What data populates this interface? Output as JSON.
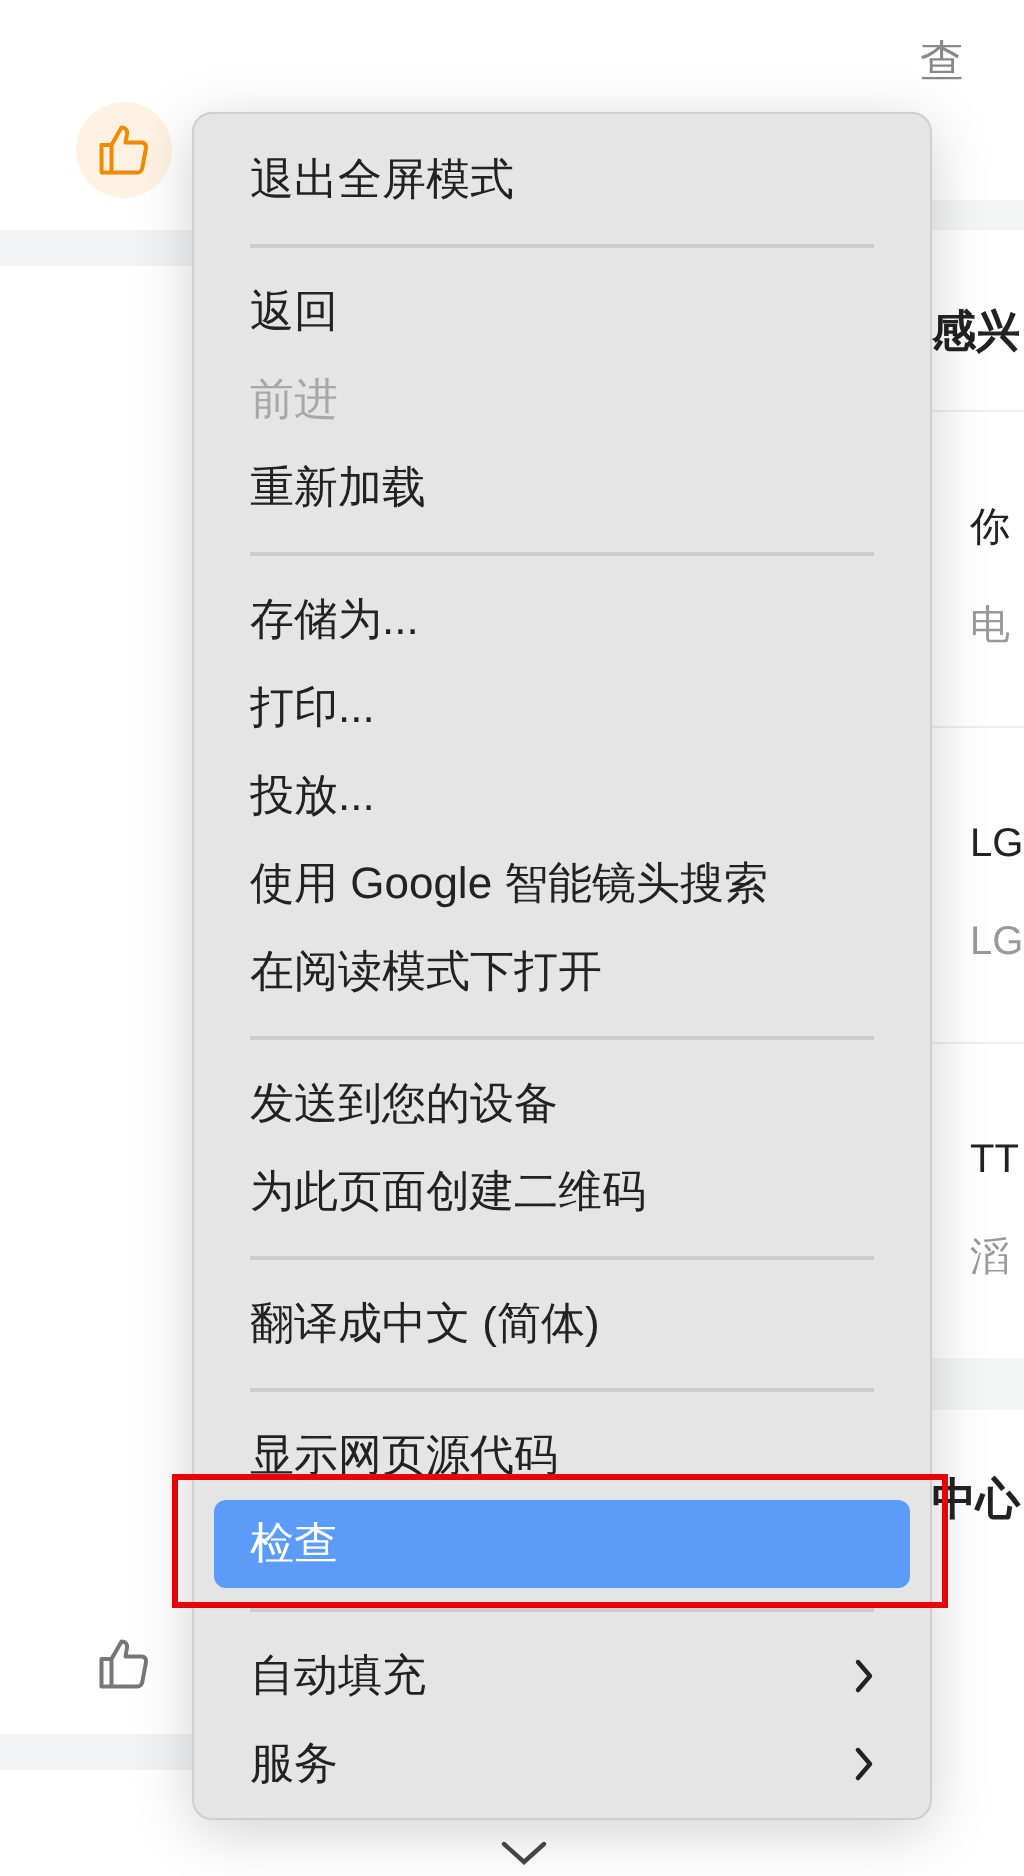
{
  "page": {
    "like_buttons": [
      {
        "liked": true
      },
      {
        "liked": false
      }
    ],
    "right_column": {
      "header": "查",
      "section_heading": "感兴",
      "entries": [
        {
          "title": "你",
          "subtitle": "电"
        },
        {
          "title": "LG",
          "subtitle": "LG"
        },
        {
          "title": "TT",
          "subtitle": "滔"
        }
      ],
      "second_heading": "中心"
    }
  },
  "context_menu": {
    "items": [
      {
        "kind": "item",
        "label": "退出全屏模式",
        "disabled": false,
        "selected": false,
        "submenu": false
      },
      {
        "kind": "separator"
      },
      {
        "kind": "item",
        "label": "返回",
        "disabled": false,
        "selected": false,
        "submenu": false
      },
      {
        "kind": "item",
        "label": "前进",
        "disabled": true,
        "selected": false,
        "submenu": false
      },
      {
        "kind": "item",
        "label": "重新加载",
        "disabled": false,
        "selected": false,
        "submenu": false
      },
      {
        "kind": "separator"
      },
      {
        "kind": "item",
        "label": "存储为...",
        "disabled": false,
        "selected": false,
        "submenu": false
      },
      {
        "kind": "item",
        "label": "打印...",
        "disabled": false,
        "selected": false,
        "submenu": false
      },
      {
        "kind": "item",
        "label": "投放...",
        "disabled": false,
        "selected": false,
        "submenu": false
      },
      {
        "kind": "item",
        "label": "使用 Google 智能镜头搜索",
        "disabled": false,
        "selected": false,
        "submenu": false
      },
      {
        "kind": "item",
        "label": "在阅读模式下打开",
        "disabled": false,
        "selected": false,
        "submenu": false
      },
      {
        "kind": "separator"
      },
      {
        "kind": "item",
        "label": "发送到您的设备",
        "disabled": false,
        "selected": false,
        "submenu": false
      },
      {
        "kind": "item",
        "label": "为此页面创建二维码",
        "disabled": false,
        "selected": false,
        "submenu": false
      },
      {
        "kind": "separator"
      },
      {
        "kind": "item",
        "label": "翻译成中文 (简体)",
        "disabled": false,
        "selected": false,
        "submenu": false
      },
      {
        "kind": "separator"
      },
      {
        "kind": "item",
        "label": "显示网页源代码",
        "disabled": false,
        "selected": false,
        "submenu": false
      },
      {
        "kind": "item",
        "label": "检查",
        "disabled": false,
        "selected": true,
        "submenu": false
      },
      {
        "kind": "separator"
      },
      {
        "kind": "item",
        "label": "自动填充",
        "disabled": false,
        "selected": false,
        "submenu": true
      },
      {
        "kind": "item",
        "label": "服务",
        "disabled": false,
        "selected": false,
        "submenu": true
      }
    ]
  }
}
